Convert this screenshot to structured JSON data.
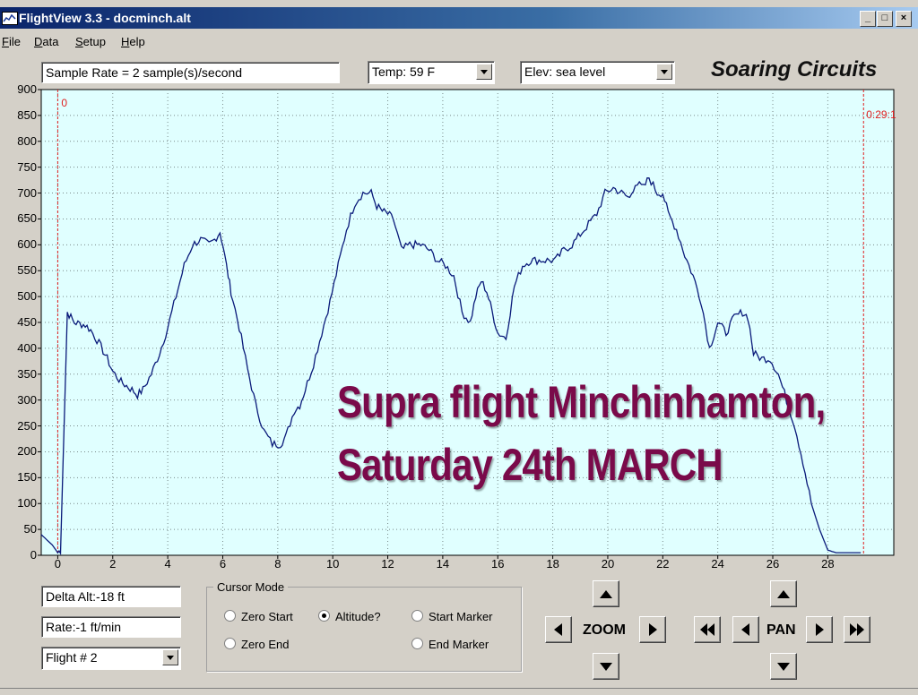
{
  "window": {
    "title": "FlightView 3.3 - docminch.alt",
    "minimize": "_",
    "maximize": "□",
    "close": "×"
  },
  "menu": [
    "File",
    "Data",
    "Setup",
    "Help"
  ],
  "toolbar": {
    "sample_rate": "Sample Rate =  2 sample(s)/second",
    "temp": "Temp:  59 F",
    "elev": "Elev: sea level",
    "brand": "Soaring Circuits"
  },
  "chart_data": {
    "type": "line",
    "x_ticks": [
      "0",
      "2",
      "4",
      "6",
      "8",
      "10",
      "12",
      "14",
      "16",
      "18",
      "20",
      "22",
      "24",
      "26",
      "28"
    ],
    "y_ticks": [
      "900",
      "850",
      "800",
      "750",
      "700",
      "650",
      "600",
      "550",
      "500",
      "450",
      "400",
      "350",
      "300",
      "250",
      "200",
      "150",
      "100",
      "50",
      "0"
    ],
    "xlim": [
      -0.6,
      30.4
    ],
    "ylim": [
      0,
      900
    ],
    "grid": true,
    "background": "#e0ffff",
    "line_color": "#0a1a7a",
    "marker_color": "#e02020",
    "start_marker_label": "0",
    "end_marker_label": "0:29:1",
    "start_marker_x": 0,
    "end_marker_x": 29.3,
    "series": [
      {
        "x": [
          -0.6,
          -0.2,
          0.0,
          0.1,
          0.35,
          0.6,
          1.0,
          1.2,
          1.5,
          1.8,
          2.0,
          2.3,
          2.7,
          2.9,
          3.1,
          3.4,
          3.7,
          4.0,
          4.3,
          4.6,
          4.9,
          5.2,
          5.5,
          5.7,
          5.9,
          6.0,
          6.2,
          6.3,
          6.6,
          6.9,
          7.2,
          7.5,
          7.8,
          8.1,
          8.3,
          8.6,
          8.8,
          9.0,
          9.3,
          9.6,
          9.9,
          10.2,
          10.5,
          10.8,
          11.1,
          11.4,
          11.6,
          11.8,
          12.0,
          12.2,
          12.5,
          12.8,
          13.0,
          13.2,
          13.5,
          13.8,
          14.1,
          14.4,
          14.7,
          15.0,
          15.2,
          15.4,
          15.6,
          15.8,
          16.0,
          16.3,
          16.6,
          16.9,
          17.2,
          17.5,
          17.8,
          18.1,
          18.4,
          18.7,
          19.0,
          19.3,
          19.6,
          19.9,
          20.2,
          20.5,
          20.8,
          21.0,
          21.3,
          21.5,
          21.8,
          22.0,
          22.2,
          22.5,
          22.8,
          23.1,
          23.4,
          23.7,
          24.0,
          24.3,
          24.6,
          24.9,
          25.1,
          25.3,
          25.6,
          25.9,
          26.2,
          26.5,
          26.8,
          27.1,
          27.4,
          27.7,
          28.0,
          28.3,
          28.6,
          28.9,
          29.2
        ],
        "y": [
          40,
          20,
          5,
          10,
          470,
          450,
          445,
          435,
          410,
          380,
          355,
          335,
          320,
          310,
          320,
          350,
          390,
          440,
          500,
          560,
          600,
          610,
          600,
          610,
          625,
          600,
          540,
          510,
          440,
          360,
          290,
          240,
          215,
          215,
          230,
          280,
          290,
          320,
          370,
          430,
          490,
          560,
          630,
          680,
          700,
          700,
          675,
          665,
          660,
          650,
          590,
          600,
          600,
          600,
          590,
          570,
          560,
          540,
          470,
          450,
          500,
          530,
          510,
          470,
          430,
          420,
          520,
          560,
          570,
          570,
          570,
          570,
          590,
          600,
          620,
          640,
          660,
          700,
          710,
          700,
          690,
          720,
          710,
          730,
          700,
          700,
          660,
          630,
          580,
          540,
          490,
          400,
          450,
          430,
          460,
          470,
          460,
          390,
          380,
          380,
          350,
          300,
          250,
          180,
          100,
          50,
          10,
          5,
          5,
          5,
          5
        ]
      }
    ]
  },
  "annotation": {
    "line1": "Supra flight Minchinhamton,",
    "line2": "Saturday 24th MARCH"
  },
  "readouts": {
    "delta_alt": "Delta Alt:-18 ft",
    "rate": "Rate:-1 ft/min",
    "flight": "Flight # 2"
  },
  "cursor_mode": {
    "label": "Cursor Mode",
    "options": [
      {
        "label": "Zero Start",
        "checked": false
      },
      {
        "label": "Altitude?",
        "checked": true
      },
      {
        "label": "Start Marker",
        "checked": false
      },
      {
        "label": "Zero End",
        "checked": false
      },
      {
        "label": "End Marker",
        "checked": false
      }
    ]
  },
  "nav": {
    "zoom_label": "ZOOM",
    "pan_label": "PAN"
  }
}
